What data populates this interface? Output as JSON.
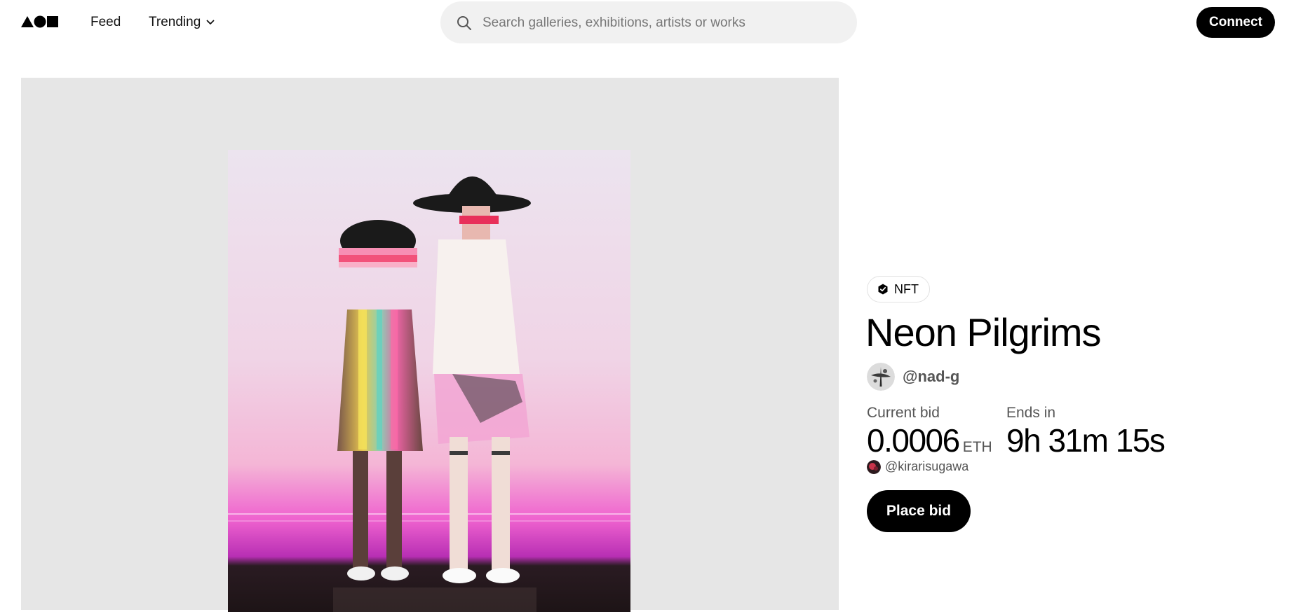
{
  "header": {
    "logo_icon": "foundation-logo-icon",
    "nav": {
      "feed": "Feed",
      "trending": "Trending"
    },
    "search": {
      "placeholder": "Search galleries, exhibitions, artists or works",
      "value": ""
    },
    "connect_label": "Connect"
  },
  "artwork": {
    "image": "artwork-image",
    "badge": "NFT",
    "title": "Neon Pilgrims",
    "artist_handle": "@nad-g"
  },
  "auction": {
    "current_bid_label": "Current bid",
    "current_bid_value": "0.0006",
    "currency": "ETH",
    "bidder_handle": "@kirarisugawa",
    "ends_in_label": "Ends in",
    "countdown": "9h 31m 15s",
    "place_bid_label": "Place bid"
  },
  "colors": {
    "primary": "#000000",
    "background": "#ffffff",
    "panel": "#e6e6e6",
    "search_bg": "#f1f1f1",
    "muted_text": "#555555"
  }
}
